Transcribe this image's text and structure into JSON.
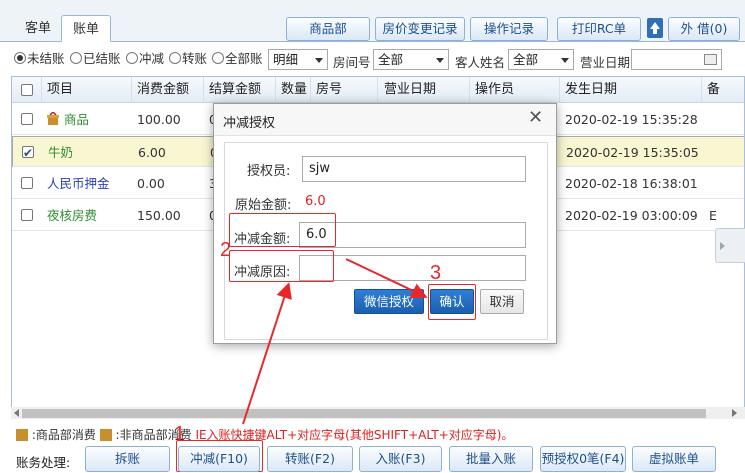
{
  "tabs": [
    "客单",
    "账单"
  ],
  "toolbar": {
    "goods_dept": "商品部",
    "price_change": "房价变更记录",
    "op_record": "操作记录",
    "print_rc": "打印RC单",
    "outside_borrow": "外 借(0)"
  },
  "filters": {
    "radios": [
      "未结账",
      "已结账",
      "冲减",
      "转账",
      "全部账"
    ],
    "detail_select": "明细",
    "room_label": "房间号",
    "room_select": "全部",
    "guest_label": "客人姓名",
    "guest_select": "全部",
    "bizdate_label": "营业日期"
  },
  "grid": {
    "headers": [
      "项目",
      "消费金额",
      "结算金额",
      "数量",
      "房号",
      "营业日期",
      "操作员",
      "发生日期",
      "备"
    ],
    "rows": [
      {
        "item": "商品",
        "consume": "100.00",
        "settle": "0",
        "date": "2020-02-19 15:35:28",
        "remark": "",
        "checked": false,
        "color": "#2e8b2e"
      },
      {
        "item": "牛奶",
        "consume": "6.00",
        "settle": "0",
        "date": "2020-02-19 15:35:05",
        "remark": "",
        "checked": true,
        "color": "#2e8b2e"
      },
      {
        "item": "人民币押金",
        "consume": "0.00",
        "settle": "30",
        "date": "2020-02-18 16:38:01",
        "remark": "",
        "checked": false,
        "color": "#2a3fbf"
      },
      {
        "item": "夜核房费",
        "consume": "150.00",
        "settle": "0",
        "date": "2020-02-19 03:00:09",
        "remark": "E",
        "checked": false,
        "color": "#2e8b2e"
      }
    ]
  },
  "dialog": {
    "title": "冲减授权",
    "auth_label": "授权员:",
    "auth_value": "sjw",
    "orig_label": "原始金额:",
    "orig_value": "6.0",
    "amount_label": "冲减金额:",
    "amount_value": "6.0",
    "reason_label": "冲减原因:",
    "reason_value": "",
    "wechat_btn": "微信授权",
    "confirm_btn": "确认",
    "cancel_btn": "取消"
  },
  "annotations": {
    "n1": "1",
    "n2": "2",
    "n3": "3",
    "color": "#e8272b"
  },
  "legend": {
    "goods": "商品部消费",
    "nongoods": "非商品部消费",
    "hint": "IE入账快捷键ALT+对应字母(其他SHIFT+ALT+对应字母)。"
  },
  "bottom": {
    "label": "账务处理:",
    "buttons": [
      "拆账",
      "冲减(F10)",
      "转账(F2)",
      "入账(F3)",
      "批量入账",
      "预授权0笔(F4)",
      "虚拟账单"
    ]
  }
}
